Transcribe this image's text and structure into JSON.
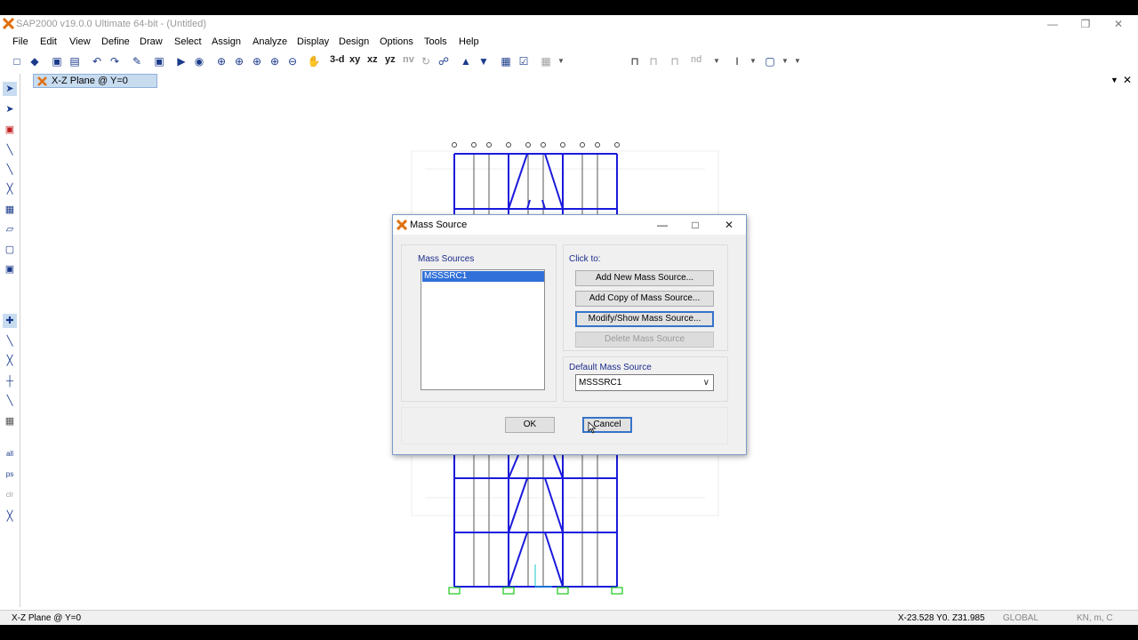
{
  "window": {
    "title": "SAP2000 v19.0.0 Ultimate 64-bit - (Untitled)"
  },
  "menu": [
    "File",
    "Edit",
    "View",
    "Define",
    "Draw",
    "Select",
    "Assign",
    "Analyze",
    "Display",
    "Design",
    "Options",
    "Tools",
    "Help"
  ],
  "toolbar": {
    "view_3d": "3-d",
    "view_xy": "xy",
    "view_xz": "xz",
    "view_yz": "yz",
    "view_nv": "nv",
    "nd": "nd"
  },
  "tab": {
    "label": "X-Z Plane @ Y=0"
  },
  "status": {
    "left": "X-Z Plane @ Y=0",
    "coords": "X-23.528  Y0.  Z31.985",
    "coordsys": "GLOBAL",
    "units": "KN, m, C"
  },
  "dialog": {
    "title": "Mass Source",
    "mass_sources_label": "Mass Sources",
    "list_items": [
      "MSSSRC1"
    ],
    "click_to_label": "Click to:",
    "add_new": "Add New Mass Source...",
    "add_copy": "Add Copy of Mass Source...",
    "modify_show": "Modify/Show Mass Source...",
    "delete": "Delete Mass Source",
    "default_label": "Default Mass Source",
    "default_value": "MSSSRC1",
    "ok": "OK",
    "cancel": "Cancel"
  },
  "colors": {
    "frame": "#1a1adc",
    "support": "#19c919",
    "accent": "#3070d8"
  }
}
